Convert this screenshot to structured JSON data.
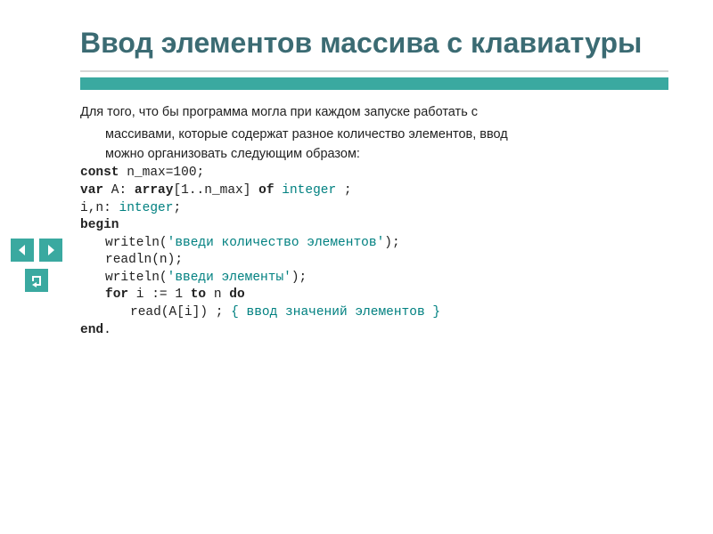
{
  "title": "Ввод элементов массива с клавиатуры",
  "intro_line1": "Для того, что бы программа могла при каждом запуске работать с",
  "intro_line2": "массивами, которые содержат разное количество элементов, ввод",
  "intro_line3": "можно организовать следующим образом:",
  "code": {
    "l1_const": "const",
    "l1_rest": " n_max=100;",
    "l2_var": "var",
    "l2_a": " A: ",
    "l2_arr": "array",
    "l2_range": "[1..n_max] ",
    "l2_of": "of",
    "l2_sp": " ",
    "l2_int": "integer",
    "l2_end": " ;",
    "l3_a": "i,n: ",
    "l3_int": "integer",
    "l3_end": ";",
    "l4": "begin",
    "l5_a": "writeln(",
    "l5_str": "'введи количество элементов'",
    "l5_b": ");",
    "l6": "readln(n);",
    "l7_a": "writeln(",
    "l7_str": "'введи элементы'",
    "l7_b": ");",
    "l8_for": "for",
    "l8_mid": " i := 1 ",
    "l8_to": "to",
    "l8_n": " n ",
    "l8_do": "do",
    "l9_a": "read(A[i]) ; ",
    "l9_cmt": "{ ввод значений элементов }",
    "l10_end": "end",
    "l10_dot": "."
  },
  "nav": {
    "prev": "prev-icon",
    "next": "next-icon",
    "up": "up-icon"
  }
}
